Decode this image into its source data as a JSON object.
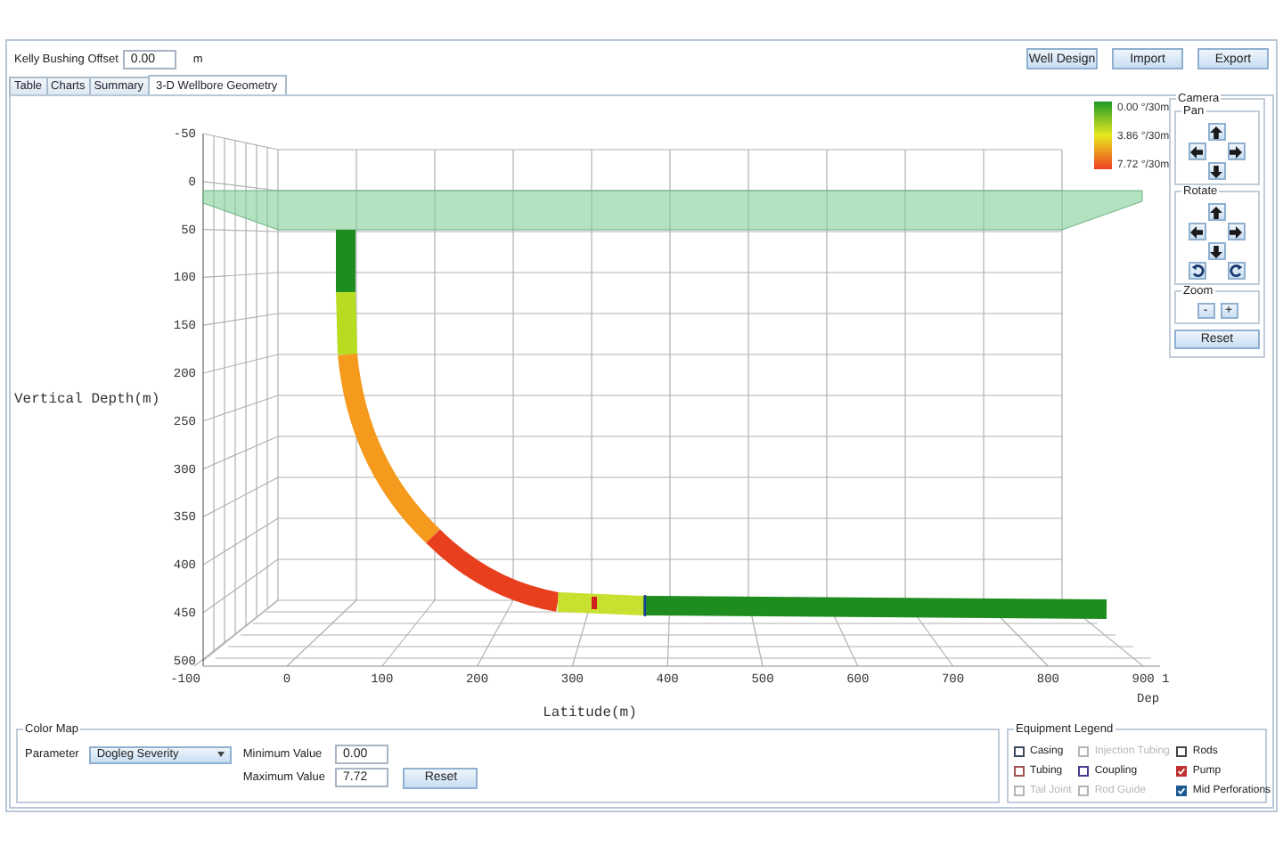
{
  "header": {
    "kelly_bushing_label": "Kelly Bushing Offset",
    "kelly_bushing_value": "0.00",
    "unit": "m",
    "buttons": [
      "Well Design",
      "Import",
      "Export"
    ]
  },
  "tabs": [
    {
      "label": "Table",
      "selected": false
    },
    {
      "label": "Charts",
      "selected": false
    },
    {
      "label": "Summary",
      "selected": false
    },
    {
      "label": "3-D Wellbore Geometry",
      "selected": true
    }
  ],
  "plot": {
    "y_axis_label": "Vertical Depth(m)",
    "y_ticks": [
      "-50",
      "0",
      "50",
      "100",
      "150",
      "200",
      "250",
      "300",
      "350",
      "400",
      "450",
      "500"
    ],
    "x_ticks": [
      "-100",
      "0",
      "100",
      "200",
      "300",
      "400",
      "500",
      "600",
      "700",
      "800",
      "900"
    ],
    "x_axis_label": "Latitude(m)",
    "z_ticks": [
      "1"
    ],
    "z_axis_label": "Dep"
  },
  "color_scale": {
    "labels": [
      "0.00 °/30m",
      "3.86 °/30m",
      "7.72 °/30m"
    ]
  },
  "camera": {
    "title": "Camera",
    "pan_title": "Pan",
    "rotate_title": "Rotate",
    "zoom_title": "Zoom",
    "zoom_buttons": [
      "-",
      "+"
    ],
    "reset": "Reset"
  },
  "color_map": {
    "title": "Color Map",
    "parameter_label": "Parameter",
    "parameter_value": "Dogleg Severity",
    "min_label": "Minimum Value",
    "min_value": "0.00",
    "max_label": "Maximum Value",
    "max_value": "7.72",
    "reset": "Reset"
  },
  "equipment_legend": {
    "title": "Equipment Legend",
    "items": [
      {
        "label": "Casing",
        "checked": false,
        "disabled": false,
        "color": "#3c4a60"
      },
      {
        "label": "Injection Tubing",
        "checked": false,
        "disabled": true,
        "color": "#b4b4b4"
      },
      {
        "label": "Rods",
        "checked": false,
        "disabled": false,
        "color": "#444444"
      },
      {
        "label": "Tubing",
        "checked": false,
        "disabled": false,
        "color": "#a05050"
      },
      {
        "label": "Coupling",
        "checked": false,
        "disabled": false,
        "color": "#4c3a90"
      },
      {
        "label": "Pump",
        "checked": true,
        "disabled": false,
        "color": "#c03030"
      },
      {
        "label": "Tail Joint",
        "checked": false,
        "disabled": true,
        "color": "#b4b4b4"
      },
      {
        "label": "Rod Guide",
        "checked": false,
        "disabled": true,
        "color": "#b4b4b4"
      },
      {
        "label": "Mid Perforations",
        "checked": true,
        "disabled": false,
        "color": "#1a5a90"
      }
    ]
  }
}
